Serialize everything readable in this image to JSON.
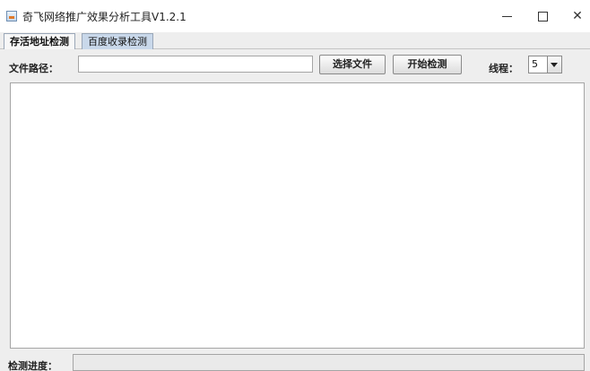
{
  "window": {
    "title": "奇飞网络推广效果分析工具V1.2.1",
    "minimize_icon": "minimize-icon",
    "maximize_icon": "maximize-icon",
    "close_icon": "close-icon",
    "close_glyph": "✕"
  },
  "tabs": [
    {
      "label": "存活地址检测",
      "active": true
    },
    {
      "label": "百度收录检测",
      "active": false
    }
  ],
  "form": {
    "path_label": "文件路径：",
    "path_value": "",
    "choose_file_label": "选择文件",
    "start_check_label": "开始检测",
    "threads_label": "线程：",
    "threads_value": "5"
  },
  "status": {
    "progress_label": "检测进度：",
    "progress_percent": 0
  }
}
